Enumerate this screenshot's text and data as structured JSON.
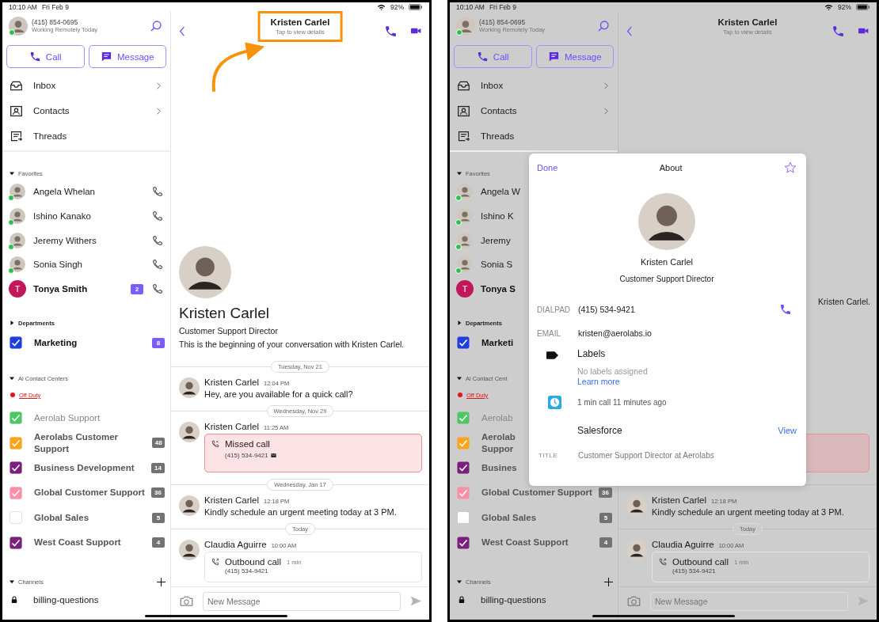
{
  "screens": [
    {
      "dimmed": false,
      "status_bar": {
        "time": "10:10 AM",
        "date": "Fri Feb 9",
        "battery": "92%"
      },
      "sidebar": {
        "profile": {
          "phone": "(415) 854-0695",
          "status": "Working Remotely Today",
          "online": true
        },
        "actions": [
          {
            "kind": "call",
            "label": "Call"
          },
          {
            "kind": "message",
            "label": "Message"
          }
        ],
        "nav": [
          {
            "kind": "inbox",
            "label": "Inbox",
            "chevron": true
          },
          {
            "kind": "contacts",
            "label": "Contacts",
            "chevron": true
          },
          {
            "kind": "threads",
            "label": "Threads",
            "chevron": false
          }
        ],
        "groups": [
          {
            "kind": "contacts",
            "title": "Favorites",
            "expanded": true,
            "items": [
              {
                "name": "Angela Whelan",
                "online": true,
                "unread": false,
                "call": true
              },
              {
                "name": "Ishino Kanako",
                "online": true,
                "unread": false,
                "call": true
              },
              {
                "name": "Jeremy Withers",
                "online": true,
                "unread": false,
                "call": true
              },
              {
                "name": "Sonia  Singh",
                "online": true,
                "unread": false,
                "call": true
              },
              {
                "name": "Tonya Smith",
                "initial": "T",
                "online": false,
                "unread": true,
                "badge": "2",
                "call": true
              }
            ]
          },
          {
            "kind": "checklist",
            "title": "Departments",
            "expanded": false,
            "items": [
              {
                "name": "Marketing",
                "checked": true,
                "color": "#1e3fe0",
                "unread": true,
                "disabled": false,
                "badge": "8"
              }
            ]
          },
          {
            "kind": "checklist",
            "title": "Ai Contact Centers",
            "expanded": true,
            "status": "Off Duty",
            "items": [
              {
                "name": "Aerolab Support",
                "checked": true,
                "color": "#4cc764",
                "unread": false,
                "disabled": true
              },
              {
                "name": "Aerolabs Customer Support",
                "checked": true,
                "color": "#ffa319",
                "unread": false,
                "disabled": false,
                "badge": "48"
              },
              {
                "name": "Business Development",
                "checked": true,
                "color": "#7b1f7e",
                "unread": false,
                "disabled": false,
                "badge": "14"
              },
              {
                "name": "Global Customer Support",
                "checked": true,
                "color": "#ff8fa5",
                "unread": false,
                "disabled": false,
                "badge": "36"
              },
              {
                "name": "Global Sales",
                "checked": false,
                "color": "#ffffff",
                "unread": false,
                "disabled": false,
                "badge": "5"
              },
              {
                "name": "West Coast Support",
                "checked": true,
                "color": "#7b1f7e",
                "unread": false,
                "disabled": false,
                "badge": "4"
              }
            ]
          },
          {
            "kind": "channels",
            "title": "Channels",
            "expanded": true,
            "add": true,
            "items": [
              {
                "name": "billing-questions",
                "private": true
              }
            ]
          }
        ]
      },
      "conversation": {
        "title": "Kristen Carlel",
        "subtitle": "Tap to view details",
        "annotated": true,
        "intro": {
          "name": "Kristen Carlel",
          "role": "Customer Support Director",
          "text": "This is the beginning of your conversation with Kristen Carlel."
        },
        "timeline": [
          {
            "kind": "divider",
            "label": "Tuesday, Nov 21"
          },
          {
            "kind": "message",
            "author": "Kristen Carlel",
            "time": "12:04 PM",
            "text": "Hey, are you available for a quick call?"
          },
          {
            "kind": "divider",
            "label": "Wednesday, Nov 29"
          },
          {
            "kind": "call",
            "missed": true,
            "author": "Kristen Carlel",
            "time": "11:25 AM",
            "title": "Missed call",
            "number": "(415) 534-9421",
            "voicemail": true
          },
          {
            "kind": "divider",
            "label": "Wednesday, Jan 17"
          },
          {
            "kind": "message",
            "author": "Kristen Carlel",
            "time": "12:18 PM",
            "text": "Kindly schedule an urgent meeting today at 3 PM."
          },
          {
            "kind": "divider",
            "label": "Today"
          },
          {
            "kind": "call",
            "missed": false,
            "author": "Claudia  Aguirre",
            "time": "10:00 AM",
            "title": "Outbound call",
            "duration": "1 min",
            "number": "(415) 534-9421",
            "voicemail": false
          }
        ],
        "composer": {
          "placeholder": "New Message"
        }
      }
    },
    {
      "dimmed": true,
      "status_bar": {
        "time": "10:10 AM",
        "date": "Fri Feb 9",
        "battery": "92%"
      },
      "sidebar": {
        "profile": {
          "phone": "(415) 854-0695",
          "status": "Working Remotely Today",
          "online": true
        },
        "actions": [
          {
            "kind": "call",
            "label": "Call"
          },
          {
            "kind": "message",
            "label": "Message"
          }
        ],
        "nav": [
          {
            "kind": "inbox",
            "label": "Inbox",
            "chevron": true
          },
          {
            "kind": "contacts",
            "label": "Contacts",
            "chevron": true
          },
          {
            "kind": "threads",
            "label": "Threads",
            "chevron": false
          }
        ],
        "groups": [
          {
            "kind": "contacts",
            "title": "Favorites",
            "expanded": true,
            "items": [
              {
                "name": "Angela W",
                "online": true,
                "unread": false
              },
              {
                "name": "Ishino K",
                "online": true,
                "unread": false
              },
              {
                "name": "Jeremy",
                "online": true,
                "unread": false
              },
              {
                "name": "Sonia  S",
                "online": true,
                "unread": false
              },
              {
                "name": "Tonya S",
                "initial": "T",
                "online": false,
                "unread": true
              }
            ]
          },
          {
            "kind": "checklist",
            "title": "Departments",
            "expanded": false,
            "items": [
              {
                "name": "Marketi",
                "checked": true,
                "color": "#1e3fe0",
                "unread": true,
                "disabled": false
              }
            ]
          },
          {
            "kind": "checklist",
            "title": "Ai Contact Cent",
            "expanded": true,
            "status": "Off Duty",
            "items": [
              {
                "name": "Aerolab",
                "checked": true,
                "color": "#4cc764",
                "unread": false,
                "disabled": true
              },
              {
                "name": "Aerolab Suppor",
                "checked": true,
                "color": "#ffa319",
                "unread": false,
                "disabled": false
              },
              {
                "name": "Busines",
                "checked": true,
                "color": "#7b1f7e",
                "unread": false,
                "disabled": false
              },
              {
                "name": "Global Customer Support",
                "checked": true,
                "color": "#ff8fa5",
                "unread": false,
                "disabled": false,
                "badge": "36"
              },
              {
                "name": "Global Sales",
                "checked": false,
                "color": "#ffffff",
                "unread": false,
                "disabled": false,
                "badge": "5"
              },
              {
                "name": "West Coast Support",
                "checked": true,
                "color": "#7b1f7e",
                "unread": false,
                "disabled": false,
                "badge": "4"
              }
            ]
          },
          {
            "kind": "channels",
            "title": "Channels",
            "expanded": true,
            "add": true,
            "items": [
              {
                "name": "billing-questions",
                "private": true
              }
            ]
          }
        ]
      },
      "conversation": {
        "title": "Kristen Carlel",
        "subtitle": "Tap to view details",
        "annotated": false,
        "intro": {
          "text": "Kristen Carlel."
        },
        "timeline": [
          {
            "kind": "call",
            "missed": true
          },
          {
            "kind": "divider"
          },
          {
            "kind": "message",
            "author": "Kristen Carlel",
            "time": "12:18 PM",
            "text": "Kindly schedule an urgent meeting today at 3 PM."
          },
          {
            "kind": "divider",
            "label": "Today"
          },
          {
            "kind": "call",
            "missed": false,
            "author": "Claudia  Aguirre",
            "time": "10:00 AM",
            "title": "Outbound call",
            "duration": "1 min",
            "number": "(415) 534-9421",
            "voicemail": false
          }
        ],
        "composer": {
          "placeholder": "New Message"
        }
      },
      "about": {
        "done": "Done",
        "title": "About",
        "starred": false,
        "name": "Kristen Carlel",
        "role": "Customer Support Director",
        "fields": [
          {
            "kind": "phone",
            "label": "DIALPAD",
            "value": "(415) 534-9421"
          },
          {
            "kind": "email",
            "label": "EMAIL",
            "value": "kristen@aerolabs.io"
          },
          {
            "kind": "labels",
            "title": "Labels",
            "note": "No labels assigned",
            "link": "Learn more"
          },
          {
            "kind": "activity",
            "text": "1 min call 11 minutes ago"
          },
          {
            "kind": "integration",
            "title": "Salesforce",
            "action": "View"
          },
          {
            "kind": "detail",
            "label": "TITLE",
            "value": "Customer Support Director at Aerolabs"
          }
        ]
      }
    }
  ]
}
